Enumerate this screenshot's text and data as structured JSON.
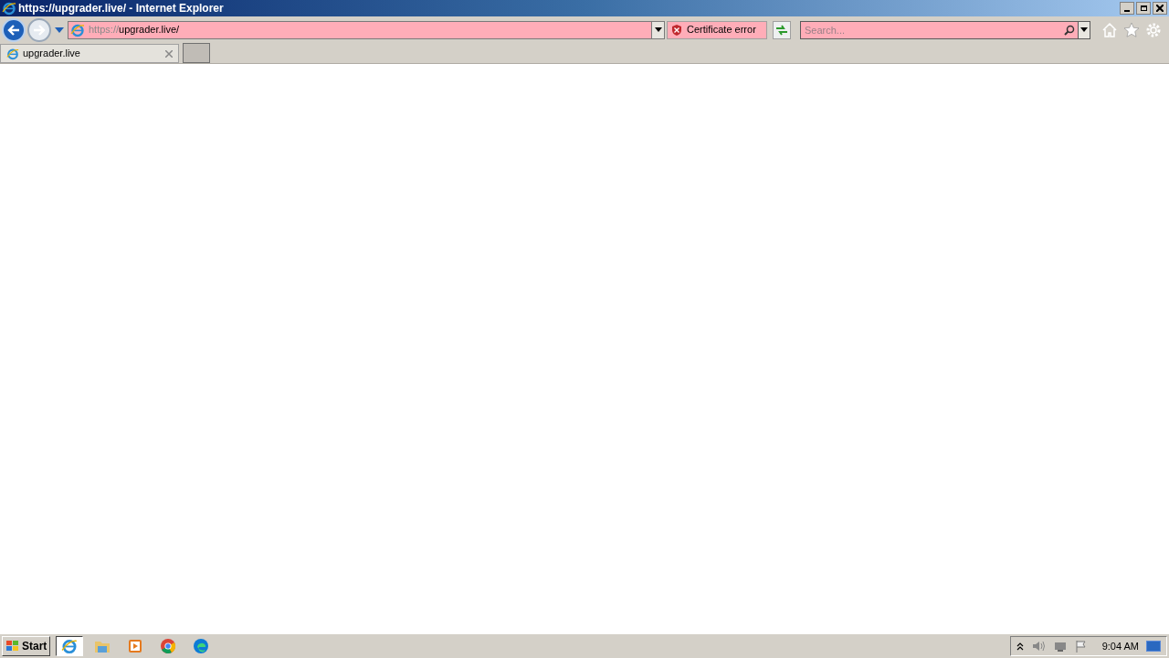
{
  "window": {
    "title": "https://upgrader.live/ - Internet Explorer"
  },
  "address": {
    "scheme": "https://",
    "rest": "upgrader.live/"
  },
  "certificate": {
    "label": "Certificate error"
  },
  "search": {
    "placeholder": "Search..."
  },
  "tabs": [
    {
      "label": "upgrader.live",
      "selected": true
    }
  ],
  "taskbar": {
    "start": "Start",
    "apps": [
      {
        "kind": "ie",
        "selected": true
      },
      {
        "kind": "folder",
        "selected": false
      },
      {
        "kind": "media",
        "selected": false
      },
      {
        "kind": "chrome",
        "selected": false
      },
      {
        "kind": "edge",
        "selected": false
      }
    ],
    "clock": "9:04 AM"
  }
}
